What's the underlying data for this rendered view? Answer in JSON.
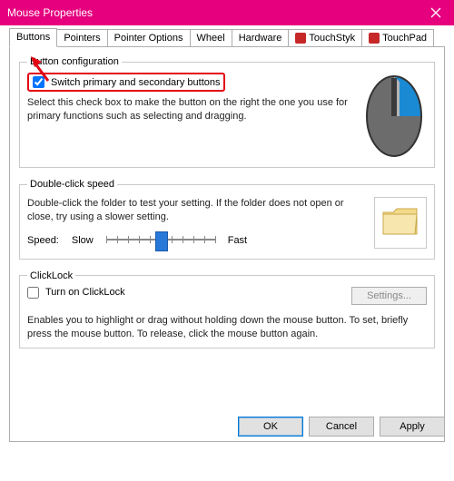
{
  "window": {
    "title": "Mouse Properties"
  },
  "tabs": {
    "buttons": "Buttons",
    "pointers": "Pointers",
    "pointerOptions": "Pointer Options",
    "wheel": "Wheel",
    "hardware": "Hardware",
    "touchstyk": "TouchStyk",
    "touchpad": "TouchPad"
  },
  "buttonConfig": {
    "legend": "Button configuration",
    "switchLabel": "Switch primary and secondary buttons",
    "switchChecked": true,
    "help": "Select this check box to make the button on the right the one you use for primary functions such as selecting and dragging."
  },
  "doubleClick": {
    "legend": "Double-click speed",
    "help": "Double-click the folder to test your setting. If the folder does not open or close, try using a slower setting.",
    "speedLabel": "Speed:",
    "slow": "Slow",
    "fast": "Fast"
  },
  "clickLock": {
    "legend": "ClickLock",
    "toggleLabel": "Turn on ClickLock",
    "toggleChecked": false,
    "settings": "Settings...",
    "help": "Enables you to highlight or drag without holding down the mouse button. To set, briefly press the mouse button. To release, click the mouse button again."
  },
  "buttons": {
    "ok": "OK",
    "cancel": "Cancel",
    "apply": "Apply"
  }
}
